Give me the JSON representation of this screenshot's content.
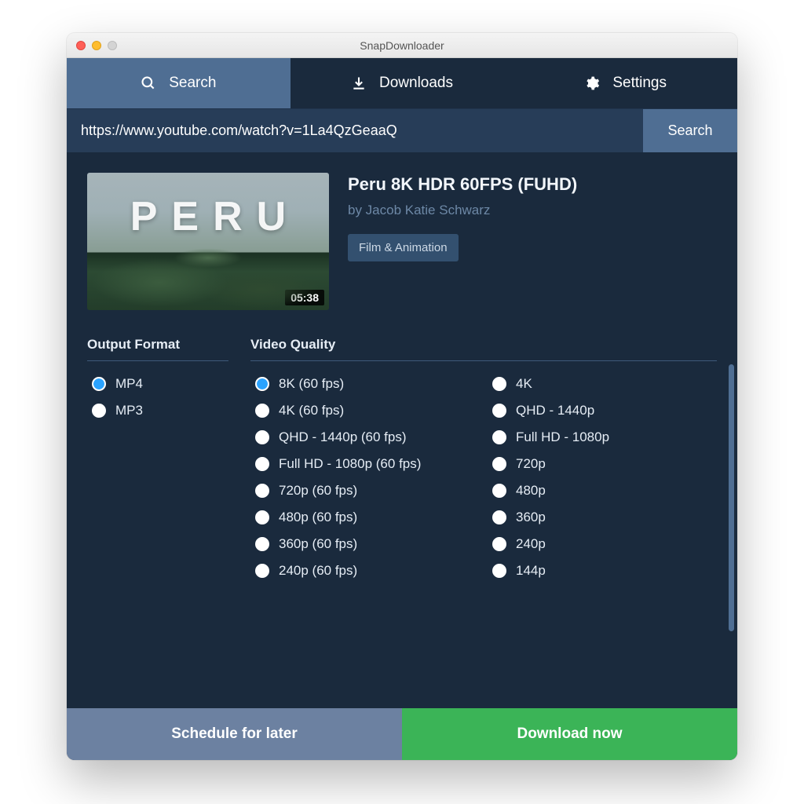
{
  "window": {
    "title": "SnapDownloader"
  },
  "tabs": {
    "search": {
      "label": "Search",
      "active": true
    },
    "downloads": {
      "label": "Downloads",
      "active": false
    },
    "settings": {
      "label": "Settings",
      "active": false
    }
  },
  "searchbar": {
    "value": "https://www.youtube.com/watch?v=1La4QzGeaaQ",
    "button": "Search"
  },
  "video": {
    "thumb_text": "PERU",
    "duration": "05:38",
    "title": "Peru 8K HDR 60FPS (FUHD)",
    "author": "by Jacob Katie Schwarz",
    "category": "Film & Animation"
  },
  "output_format": {
    "heading": "Output Format",
    "options": [
      "MP4",
      "MP3"
    ],
    "selected": "MP4"
  },
  "video_quality": {
    "heading": "Video Quality",
    "options_col1": [
      "8K (60 fps)",
      "4K (60 fps)",
      "QHD - 1440p (60 fps)",
      "Full HD - 1080p (60 fps)",
      "720p (60 fps)",
      "480p (60 fps)",
      "360p (60 fps)",
      "240p (60 fps)"
    ],
    "options_col2": [
      "4K",
      "QHD - 1440p",
      "Full HD - 1080p",
      "720p",
      "480p",
      "360p",
      "240p",
      "144p"
    ],
    "selected": "8K (60 fps)"
  },
  "actions": {
    "schedule": "Schedule for later",
    "download": "Download now"
  },
  "colors": {
    "bg": "#1a2a3d",
    "tab_inactive": "#4f6e93",
    "accent_green": "#3bb457",
    "accent_blue": "#2aa3ff"
  }
}
